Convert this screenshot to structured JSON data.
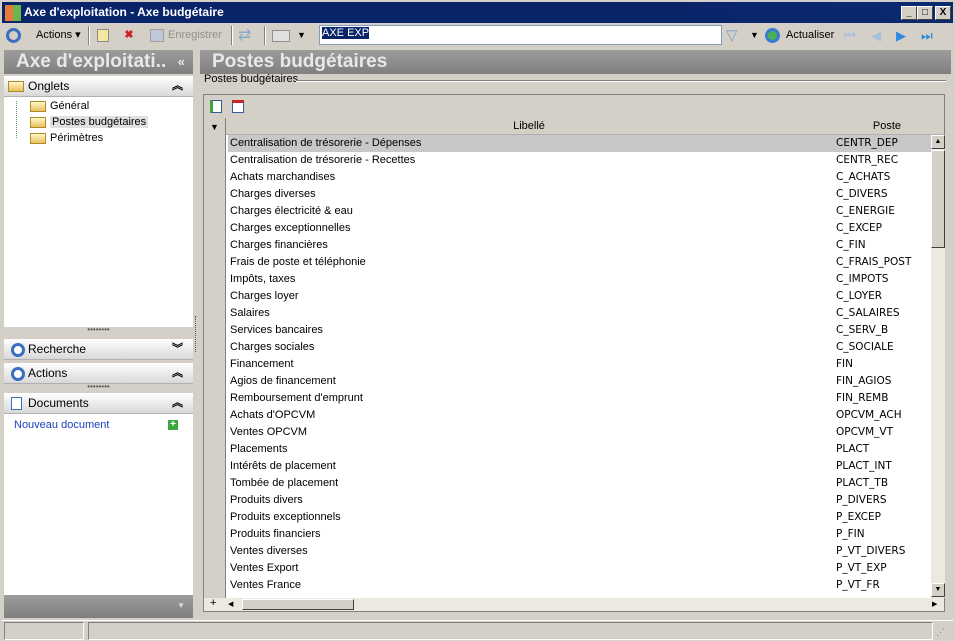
{
  "window": {
    "title": "Axe d'exploitation - Axe budgétaire",
    "min": "_",
    "max": "□",
    "close": "X"
  },
  "toolbar": {
    "actions": "Actions ▾",
    "save": "Enregistrer",
    "search_value": "AXE EXP",
    "refresh": "Actualiser"
  },
  "left": {
    "title": "Axe d'exploitati..",
    "collapse": "«",
    "onglets": {
      "label": "Onglets",
      "items": [
        "Général",
        "Postes budgétaires",
        "Périmètres"
      ],
      "selected": 1
    },
    "recherche": "Recherche",
    "actions": "Actions",
    "documents": "Documents",
    "new_doc": "Nouveau document"
  },
  "main": {
    "title": "Postes budgétaires",
    "group": "Postes budgétaires",
    "columns": {
      "libelle": "Libellé",
      "poste": "Poste"
    },
    "rows": [
      {
        "libelle": "Centralisation de trésorerie - Dépenses",
        "poste": "CENTR_DEP"
      },
      {
        "libelle": "Centralisation de trésorerie - Recettes",
        "poste": "CENTR_REC"
      },
      {
        "libelle": "Achats marchandises",
        "poste": "C_ACHATS"
      },
      {
        "libelle": "Charges diverses",
        "poste": "C_DIVERS"
      },
      {
        "libelle": "Charges électricité & eau",
        "poste": "C_ENERGIE"
      },
      {
        "libelle": "Charges exceptionnelles",
        "poste": "C_EXCEP"
      },
      {
        "libelle": "Charges financières",
        "poste": "C_FIN"
      },
      {
        "libelle": "Frais de poste et téléphonie",
        "poste": "C_FRAIS_POST"
      },
      {
        "libelle": "Impôts, taxes",
        "poste": "C_IMPOTS"
      },
      {
        "libelle": "Charges loyer",
        "poste": "C_LOYER"
      },
      {
        "libelle": "Salaires",
        "poste": "C_SALAIRES"
      },
      {
        "libelle": "Services bancaires",
        "poste": "C_SERV_B"
      },
      {
        "libelle": "Charges sociales",
        "poste": "C_SOCIALE"
      },
      {
        "libelle": "Financement",
        "poste": "FIN"
      },
      {
        "libelle": "Agios de financement",
        "poste": "FIN_AGIOS"
      },
      {
        "libelle": "Remboursement d'emprunt",
        "poste": "FIN_REMB"
      },
      {
        "libelle": "Achats d'OPCVM",
        "poste": "OPCVM_ACH"
      },
      {
        "libelle": "Ventes OPCVM",
        "poste": "OPCVM_VT"
      },
      {
        "libelle": "Placements",
        "poste": "PLACT"
      },
      {
        "libelle": "Intérêts de placement",
        "poste": "PLACT_INT"
      },
      {
        "libelle": "Tombée de placement",
        "poste": "PLACT_TB"
      },
      {
        "libelle": "Produits divers",
        "poste": "P_DIVERS"
      },
      {
        "libelle": "Produits exceptionnels",
        "poste": "P_EXCEP"
      },
      {
        "libelle": "Produits financiers",
        "poste": "P_FIN"
      },
      {
        "libelle": "Ventes diverses",
        "poste": "P_VT_DIVERS"
      },
      {
        "libelle": "Ventes Export",
        "poste": "P_VT_EXP"
      },
      {
        "libelle": "Ventes France",
        "poste": "P_VT_FR"
      }
    ]
  }
}
